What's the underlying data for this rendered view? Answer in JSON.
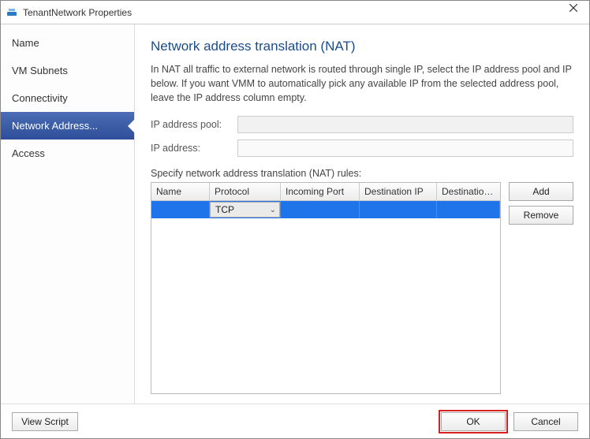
{
  "window": {
    "title": "TenantNetwork Properties"
  },
  "sidebar": {
    "items": [
      {
        "label": "Name"
      },
      {
        "label": "VM Subnets"
      },
      {
        "label": "Connectivity"
      },
      {
        "label": "Network Address..."
      },
      {
        "label": "Access"
      }
    ]
  },
  "main": {
    "heading": "Network address translation (NAT)",
    "description": "In NAT all traffic to external network is routed through single IP, select the IP address pool and IP below. If you want VMM to automatically pick any available IP from the selected address pool, leave the IP address column empty.",
    "ip_pool_label": "IP address pool:",
    "ip_pool_value": "",
    "ip_addr_label": "IP address:",
    "ip_addr_value": "",
    "rules_label": "Specify network address translation (NAT) rules:",
    "columns": {
      "name": "Name",
      "protocol": "Protocol",
      "incoming": "Incoming Port",
      "dip": "Destination IP",
      "dport": "Destination P..."
    },
    "rows": [
      {
        "name": "",
        "protocol": "TCP",
        "incoming": "",
        "dip": "",
        "dport": ""
      }
    ],
    "buttons": {
      "add": "Add",
      "remove": "Remove"
    }
  },
  "footer": {
    "view_script": "View Script",
    "ok": "OK",
    "cancel": "Cancel"
  }
}
